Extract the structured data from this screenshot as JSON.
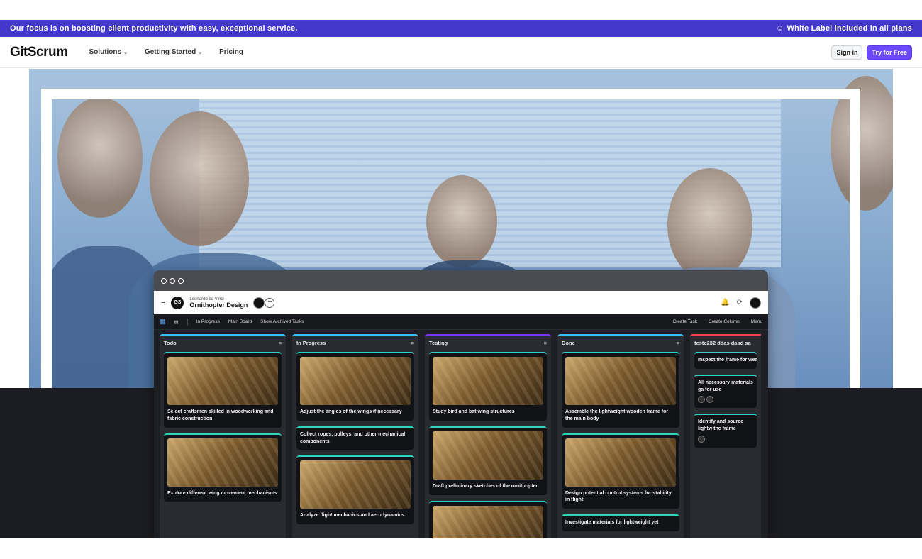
{
  "promo": {
    "left_text": "Our focus is on boosting client productivity with easy, exceptional service.",
    "right_text": "White Label included in all plans",
    "right_icon": "smile-icon"
  },
  "nav": {
    "logo": "GitScrum",
    "items": [
      {
        "label": "Solutions",
        "dropdown": true
      },
      {
        "label": "Getting Started",
        "dropdown": true
      },
      {
        "label": "Pricing",
        "dropdown": false
      }
    ],
    "sign_in": "Sign in",
    "try_free": "Try for Free"
  },
  "app": {
    "project_owner": "Leonardo da Vinci",
    "project_name": "Ornithopter Design",
    "toolbar": {
      "left": [
        "In Progress",
        "Main Board",
        "Show Archived Tasks"
      ],
      "right": [
        "Create Task",
        "Create Column",
        "Menu"
      ]
    },
    "columns": [
      {
        "name": "Todo",
        "color": "#38bdf8",
        "cards": [
          {
            "title": "Select craftsmen skilled in woodworking and fabric construction",
            "image": true
          },
          {
            "title": "Explore different wing movement mechanisms",
            "image": true
          }
        ]
      },
      {
        "name": "In Progress",
        "color": "#38bdf8",
        "cards": [
          {
            "title": "Adjust the angles of the wings if necessary",
            "image": true
          },
          {
            "title": "Collect ropes, pulleys, and other mechanical components",
            "image": false
          },
          {
            "title": "Analyze flight mechanics and aerodynamics",
            "image": true
          }
        ]
      },
      {
        "name": "Testing",
        "color": "#7c3aed",
        "cards": [
          {
            "title": "Study bird and bat wing structures",
            "image": true
          },
          {
            "title": "Draft preliminary sketches of the ornithopter",
            "image": true
          },
          {
            "title": "",
            "image": true
          }
        ]
      },
      {
        "name": "Done",
        "color": "#38bdf8",
        "cards": [
          {
            "title": "Assemble the lightweight wooden frame for the main body",
            "image": true
          },
          {
            "title": "Design potential control systems for stability in flight",
            "image": true
          },
          {
            "title": "Investigate materials for lightweight yet",
            "image": false
          }
        ]
      },
      {
        "name": "teste232 ddas dasd sa",
        "color": "#ef4444",
        "cards": [
          {
            "title": "Inspect the frame for wea",
            "image": false
          },
          {
            "title": "All necessary materials ga for use",
            "image": false
          },
          {
            "title": "Identify and source lightw the frame",
            "image": false
          }
        ]
      }
    ]
  }
}
